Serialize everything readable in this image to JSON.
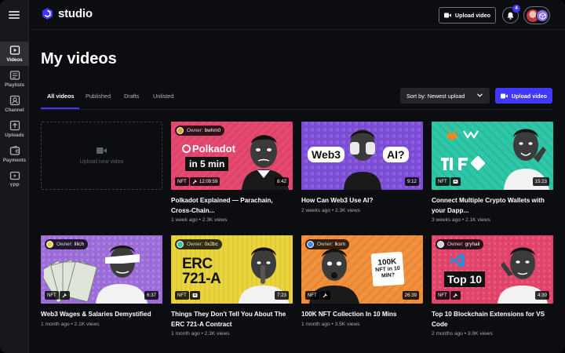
{
  "app": {
    "name": "studio",
    "page_title": "My videos",
    "notification_count": "4",
    "upload_video_label": "Upload video"
  },
  "sidebar": {
    "items": [
      {
        "label": "Videos",
        "icon": "video-icon",
        "active": true
      },
      {
        "label": "Playlists",
        "icon": "playlist-icon",
        "active": false
      },
      {
        "label": "Channel",
        "icon": "channel-icon",
        "active": false
      },
      {
        "label": "Uploads",
        "icon": "upload-icon",
        "active": false
      },
      {
        "label": "Payments",
        "icon": "wallet-icon",
        "active": false
      },
      {
        "label": "YPP",
        "icon": "ypp-icon",
        "active": false
      }
    ]
  },
  "tabs": [
    {
      "label": "All videos",
      "active": true
    },
    {
      "label": "Published",
      "active": false
    },
    {
      "label": "Drafts",
      "active": false
    },
    {
      "label": "Unlisted",
      "active": false
    }
  ],
  "sort": {
    "label": "Sort by: Newest upload"
  },
  "upload_placeholder": {
    "label": "Upload new video"
  },
  "videos": [
    {
      "title": "Polkadot Explained — Parachain, Cross-Chain...",
      "meta": "1 week ago • 2.3K views",
      "owner": "bwhm0",
      "duration": "8:42",
      "nft": "NFT",
      "extra": "12:09:59",
      "thumb_text": "Polkadot",
      "thumb_text2": "in 5 min",
      "bg": "#e0426a"
    },
    {
      "title": "How Can Web3 Use AI?",
      "meta": "2 weeks ago • 2.3K views",
      "owner": "",
      "duration": "9:12",
      "nft": "",
      "extra": "",
      "thumb_text": "Web3",
      "thumb_text2": "AI?",
      "bg": "#7b4bd6"
    },
    {
      "title": "Connect Multiple Crypto Wallets with your Dapp...",
      "meta": "3 weeks ago • 2.1K views",
      "owner": "",
      "duration": "15:23",
      "nft": "NFT",
      "extra": "",
      "thumb_text": "",
      "thumb_text2": "",
      "bg": "#2ec7a8"
    },
    {
      "title": "Web3 Wages & Salaries Demystified",
      "meta": "1 month ago • 2.1K views",
      "owner": "lilich",
      "duration": "6:37",
      "nft": "NFT",
      "extra": "",
      "thumb_text": "",
      "thumb_text2": "",
      "bg": "#9b6bd8"
    },
    {
      "title": "Things They Don't Tell You About The ERC 721-A Contract",
      "meta": "1 month ago • 2.3K views",
      "owner": "0x2bc",
      "duration": "7:23",
      "nft": "NFT",
      "extra": "",
      "thumb_text": "ERC",
      "thumb_text2": "721-A",
      "bg": "#e9d43c"
    },
    {
      "title": "100K NFT Collection In 10 Mins",
      "meta": "1 month ago • 3.5K views",
      "owner": "lksrn",
      "duration": "26:39",
      "nft": "NFT",
      "extra": "",
      "thumb_text": "100K",
      "thumb_text2": "NFT in 10 MIN?",
      "bg": "#f2903b"
    },
    {
      "title": "Top 10 Blockchain Extensions for VS Code",
      "meta": "2 months ago • 3.9K views",
      "owner": "gryhail",
      "duration": "4:39",
      "nft": "NFT",
      "extra": "",
      "thumb_text": "Top 10",
      "thumb_text2": "",
      "bg": "#e0426a"
    }
  ],
  "owner_prefix": "Owner:",
  "colors": {
    "accent": "#4038ff",
    "background": "#0c0d10",
    "rail": "#17181b"
  }
}
